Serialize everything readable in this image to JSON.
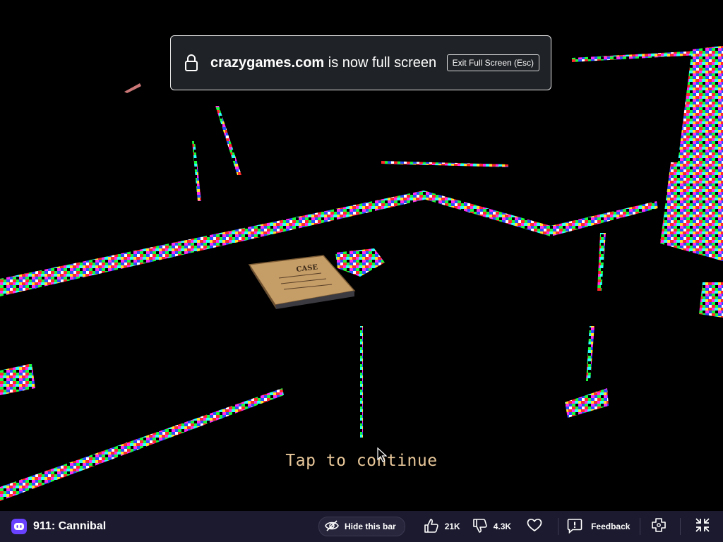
{
  "fullscreen_notice": {
    "domain": "crazygames.com",
    "message": "is now full screen",
    "exit_label": "Exit Full Screen (Esc)"
  },
  "game_overlay": {
    "prompt": "Tap to continue"
  },
  "bottom_bar": {
    "game_title": "911: Cannibal",
    "hide_label": "Hide this bar",
    "likes": "21K",
    "dislikes": "4.3K",
    "feedback_label": "Feedback"
  },
  "colors": {
    "bar_background": "#1b1a2e",
    "brand_purple": "#6842ff",
    "prompt_text": "#e8c79a"
  },
  "icons": [
    "lock-icon",
    "crazygames-logo-icon",
    "eye-slash-icon",
    "thumbs-up-icon",
    "thumbs-down-icon",
    "heart-icon",
    "feedback-icon",
    "gamepad-icon",
    "exit-fullscreen-icon",
    "cursor-icon"
  ]
}
